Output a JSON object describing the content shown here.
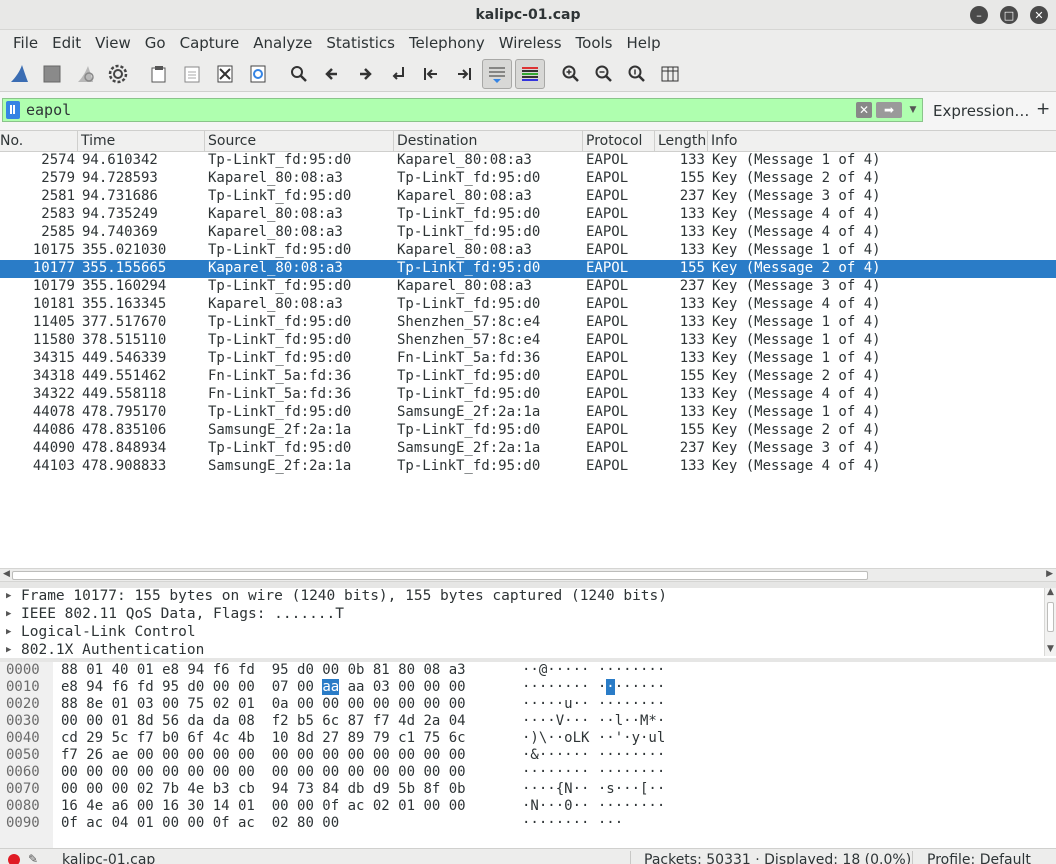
{
  "window": {
    "title": "kalipc-01.cap",
    "buttons": [
      "minimize",
      "maximize",
      "close"
    ]
  },
  "menu": [
    "File",
    "Edit",
    "View",
    "Go",
    "Capture",
    "Analyze",
    "Statistics",
    "Telephony",
    "Wireless",
    "Tools",
    "Help"
  ],
  "toolbar_icons": [
    "shark-fin-start-icon",
    "stop-icon",
    "restart-icon",
    "options-gear-icon",
    "open-file-icon",
    "save-file-icon",
    "close-file-icon",
    "reload-icon",
    "find-icon",
    "back-arrow-icon",
    "forward-arrow-icon",
    "go-to-packet-icon",
    "first-packet-icon",
    "last-packet-icon",
    "autoscroll-icon",
    "colorize-icon",
    "zoom-in-icon",
    "zoom-out-icon",
    "zoom-normal-icon",
    "resize-columns-icon"
  ],
  "filter": {
    "value": "eapol",
    "expression_label": "Expression…",
    "plus_label": "+"
  },
  "columns": {
    "no": "No.",
    "time": "Time",
    "source": "Source",
    "destination": "Destination",
    "protocol": "Protocol",
    "length": "Length",
    "info": "Info"
  },
  "packets": [
    {
      "no": "2574",
      "time": "94.610342",
      "src": "Tp-LinkT_fd:95:d0",
      "dst": "Kaparel_80:08:a3",
      "proto": "EAPOL",
      "len": "133",
      "info": "Key (Message 1 of 4)"
    },
    {
      "no": "2579",
      "time": "94.728593",
      "src": "Kaparel_80:08:a3",
      "dst": "Tp-LinkT_fd:95:d0",
      "proto": "EAPOL",
      "len": "155",
      "info": "Key (Message 2 of 4)"
    },
    {
      "no": "2581",
      "time": "94.731686",
      "src": "Tp-LinkT_fd:95:d0",
      "dst": "Kaparel_80:08:a3",
      "proto": "EAPOL",
      "len": "237",
      "info": "Key (Message 3 of 4)"
    },
    {
      "no": "2583",
      "time": "94.735249",
      "src": "Kaparel_80:08:a3",
      "dst": "Tp-LinkT_fd:95:d0",
      "proto": "EAPOL",
      "len": "133",
      "info": "Key (Message 4 of 4)"
    },
    {
      "no": "2585",
      "time": "94.740369",
      "src": "Kaparel_80:08:a3",
      "dst": "Tp-LinkT_fd:95:d0",
      "proto": "EAPOL",
      "len": "133",
      "info": "Key (Message 4 of 4)"
    },
    {
      "no": "10175",
      "time": "355.021030",
      "src": "Tp-LinkT_fd:95:d0",
      "dst": "Kaparel_80:08:a3",
      "proto": "EAPOL",
      "len": "133",
      "info": "Key (Message 1 of 4)"
    },
    {
      "no": "10177",
      "time": "355.155665",
      "src": "Kaparel_80:08:a3",
      "dst": "Tp-LinkT_fd:95:d0",
      "proto": "EAPOL",
      "len": "155",
      "info": "Key (Message 2 of 4)",
      "selected": true
    },
    {
      "no": "10179",
      "time": "355.160294",
      "src": "Tp-LinkT_fd:95:d0",
      "dst": "Kaparel_80:08:a3",
      "proto": "EAPOL",
      "len": "237",
      "info": "Key (Message 3 of 4)"
    },
    {
      "no": "10181",
      "time": "355.163345",
      "src": "Kaparel_80:08:a3",
      "dst": "Tp-LinkT_fd:95:d0",
      "proto": "EAPOL",
      "len": "133",
      "info": "Key (Message 4 of 4)"
    },
    {
      "no": "11405",
      "time": "377.517670",
      "src": "Tp-LinkT_fd:95:d0",
      "dst": "Shenzhen_57:8c:e4",
      "proto": "EAPOL",
      "len": "133",
      "info": "Key (Message 1 of 4)"
    },
    {
      "no": "11580",
      "time": "378.515110",
      "src": "Tp-LinkT_fd:95:d0",
      "dst": "Shenzhen_57:8c:e4",
      "proto": "EAPOL",
      "len": "133",
      "info": "Key (Message 1 of 4)"
    },
    {
      "no": "34315",
      "time": "449.546339",
      "src": "Tp-LinkT_fd:95:d0",
      "dst": "Fn-LinkT_5a:fd:36",
      "proto": "EAPOL",
      "len": "133",
      "info": "Key (Message 1 of 4)"
    },
    {
      "no": "34318",
      "time": "449.551462",
      "src": "Fn-LinkT_5a:fd:36",
      "dst": "Tp-LinkT_fd:95:d0",
      "proto": "EAPOL",
      "len": "155",
      "info": "Key (Message 2 of 4)"
    },
    {
      "no": "34322",
      "time": "449.558118",
      "src": "Fn-LinkT_5a:fd:36",
      "dst": "Tp-LinkT_fd:95:d0",
      "proto": "EAPOL",
      "len": "133",
      "info": "Key (Message 4 of 4)"
    },
    {
      "no": "44078",
      "time": "478.795170",
      "src": "Tp-LinkT_fd:95:d0",
      "dst": "SamsungE_2f:2a:1a",
      "proto": "EAPOL",
      "len": "133",
      "info": "Key (Message 1 of 4)"
    },
    {
      "no": "44086",
      "time": "478.835106",
      "src": "SamsungE_2f:2a:1a",
      "dst": "Tp-LinkT_fd:95:d0",
      "proto": "EAPOL",
      "len": "155",
      "info": "Key (Message 2 of 4)"
    },
    {
      "no": "44090",
      "time": "478.848934",
      "src": "Tp-LinkT_fd:95:d0",
      "dst": "SamsungE_2f:2a:1a",
      "proto": "EAPOL",
      "len": "237",
      "info": "Key (Message 3 of 4)"
    },
    {
      "no": "44103",
      "time": "478.908833",
      "src": "SamsungE_2f:2a:1a",
      "dst": "Tp-LinkT_fd:95:d0",
      "proto": "EAPOL",
      "len": "133",
      "info": "Key (Message 4 of 4)"
    }
  ],
  "details": [
    "Frame 10177: 155 bytes on wire (1240 bits), 155 bytes captured (1240 bits)",
    "IEEE 802.11 QoS Data, Flags: .......T",
    "Logical-Link Control",
    "802.1X Authentication"
  ],
  "bytes": [
    {
      "off": "0000",
      "hex_a": "88 01 40 01 e8 94 f6 fd",
      "hex_b": "95 d0 00 0b 81 80 08 a3",
      "ascii": "··@····· ········"
    },
    {
      "off": "0010",
      "hex_a": "e8 94 f6 fd 95 d0 00 00",
      "hex_b": "07 00 aa aa 03 00 00 00",
      "ascii": "········ ········",
      "highlight_byte": "aa",
      "highlight_char": "·"
    },
    {
      "off": "0020",
      "hex_a": "88 8e 01 03 00 75 02 01",
      "hex_b": "0a 00 00 00 00 00 00 00",
      "ascii": "·····u·· ········"
    },
    {
      "off": "0030",
      "hex_a": "00 00 01 8d 56 da da 08",
      "hex_b": "f2 b5 6c 87 f7 4d 2a 04",
      "ascii": "····V··· ··l··M*·"
    },
    {
      "off": "0040",
      "hex_a": "cd 29 5c f7 b0 6f 4c 4b",
      "hex_b": "10 8d 27 89 79 c1 75 6c",
      "ascii": "·)\\··oLK ··'·y·ul"
    },
    {
      "off": "0050",
      "hex_a": "f7 26 ae 00 00 00 00 00",
      "hex_b": "00 00 00 00 00 00 00 00",
      "ascii": "·&······ ········"
    },
    {
      "off": "0060",
      "hex_a": "00 00 00 00 00 00 00 00",
      "hex_b": "00 00 00 00 00 00 00 00",
      "ascii": "········ ········"
    },
    {
      "off": "0070",
      "hex_a": "00 00 00 02 7b 4e b3 cb",
      "hex_b": "94 73 84 db d9 5b 8f 0b",
      "ascii": "····{N·· ·s···[··"
    },
    {
      "off": "0080",
      "hex_a": "16 4e a6 00 16 30 14 01",
      "hex_b": "00 00 0f ac 02 01 00 00",
      "ascii": "·N···0·· ········"
    },
    {
      "off": "0090",
      "hex_a": "0f ac 04 01 00 00 0f ac",
      "hex_b": "02 80 00",
      "ascii": "········ ···"
    }
  ],
  "status": {
    "file": "kalipc-01.cap",
    "packets": "Packets: 50331 · Displayed: 18 (0.0%)",
    "profile": "Profile: Default"
  },
  "colors": {
    "selection": "#2a7cc7",
    "filter_valid": "#afffaf"
  }
}
